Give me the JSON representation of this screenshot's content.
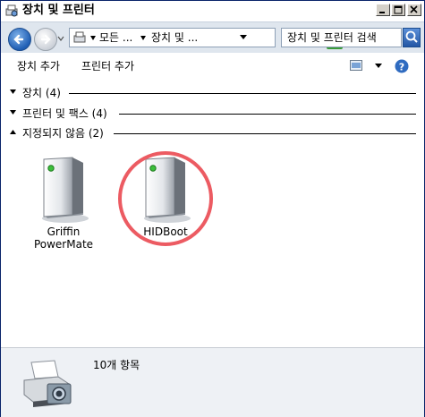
{
  "window": {
    "title": "장치 및 프린터",
    "buttons": [
      "minimize",
      "maximize",
      "close"
    ]
  },
  "address_bar": {
    "crumbs": [
      "모든 ...",
      "장치 및 ..."
    ],
    "search_placeholder": "장치 및 프린터 검색"
  },
  "toolbar": {
    "add_device": "장치 추가",
    "add_printer": "프린터 추가"
  },
  "groups": [
    {
      "label": "장치 (4)",
      "expanded": false
    },
    {
      "label": "프린터 및 팩스 (4)",
      "expanded": false
    },
    {
      "label": "지정되지 않음 (2)",
      "expanded": true
    }
  ],
  "devices": [
    {
      "line1": "Griffin",
      "line2": "PowerMate",
      "icon": "generic-device-icon"
    },
    {
      "line1": "HIDBoot",
      "line2": "",
      "icon": "generic-device-icon",
      "highlighted": true
    }
  ],
  "details": {
    "count": "10개 항목",
    "icon": "printer-camera-icon"
  },
  "colors": {
    "highlight_circle": "#ec5b62",
    "address_bg": "#dfe6ee",
    "details_bg": "#eef1f5"
  }
}
